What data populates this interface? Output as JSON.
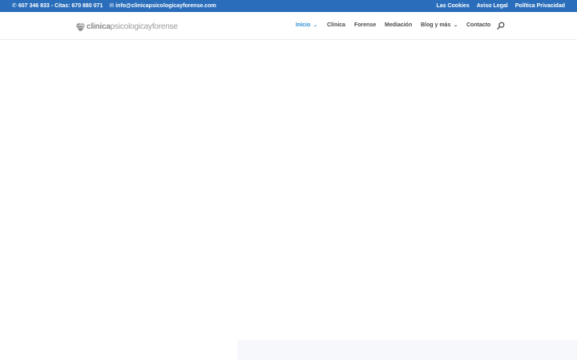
{
  "topbar": {
    "phone": "607 346 833 - Citas: 670 880 071",
    "email": "info@clinicapsicologicayforense.com",
    "links": [
      "Las Cookies",
      "Aviso Legal",
      "Política Privacidad"
    ],
    "bg_color": "#2a6ebb"
  },
  "header": {
    "logo": {
      "part1": "clinica",
      "part2": "psicologica",
      "part3": "yforense"
    },
    "nav": [
      {
        "label": "Inicio",
        "active": true,
        "has_dropdown": true
      },
      {
        "label": "Clínica"
      },
      {
        "label": "Forense"
      },
      {
        "label": "Mediación"
      },
      {
        "label": "Blog y más",
        "has_dropdown": true
      },
      {
        "label": "Contacto"
      }
    ],
    "accent_color": "#2a8fd6"
  }
}
